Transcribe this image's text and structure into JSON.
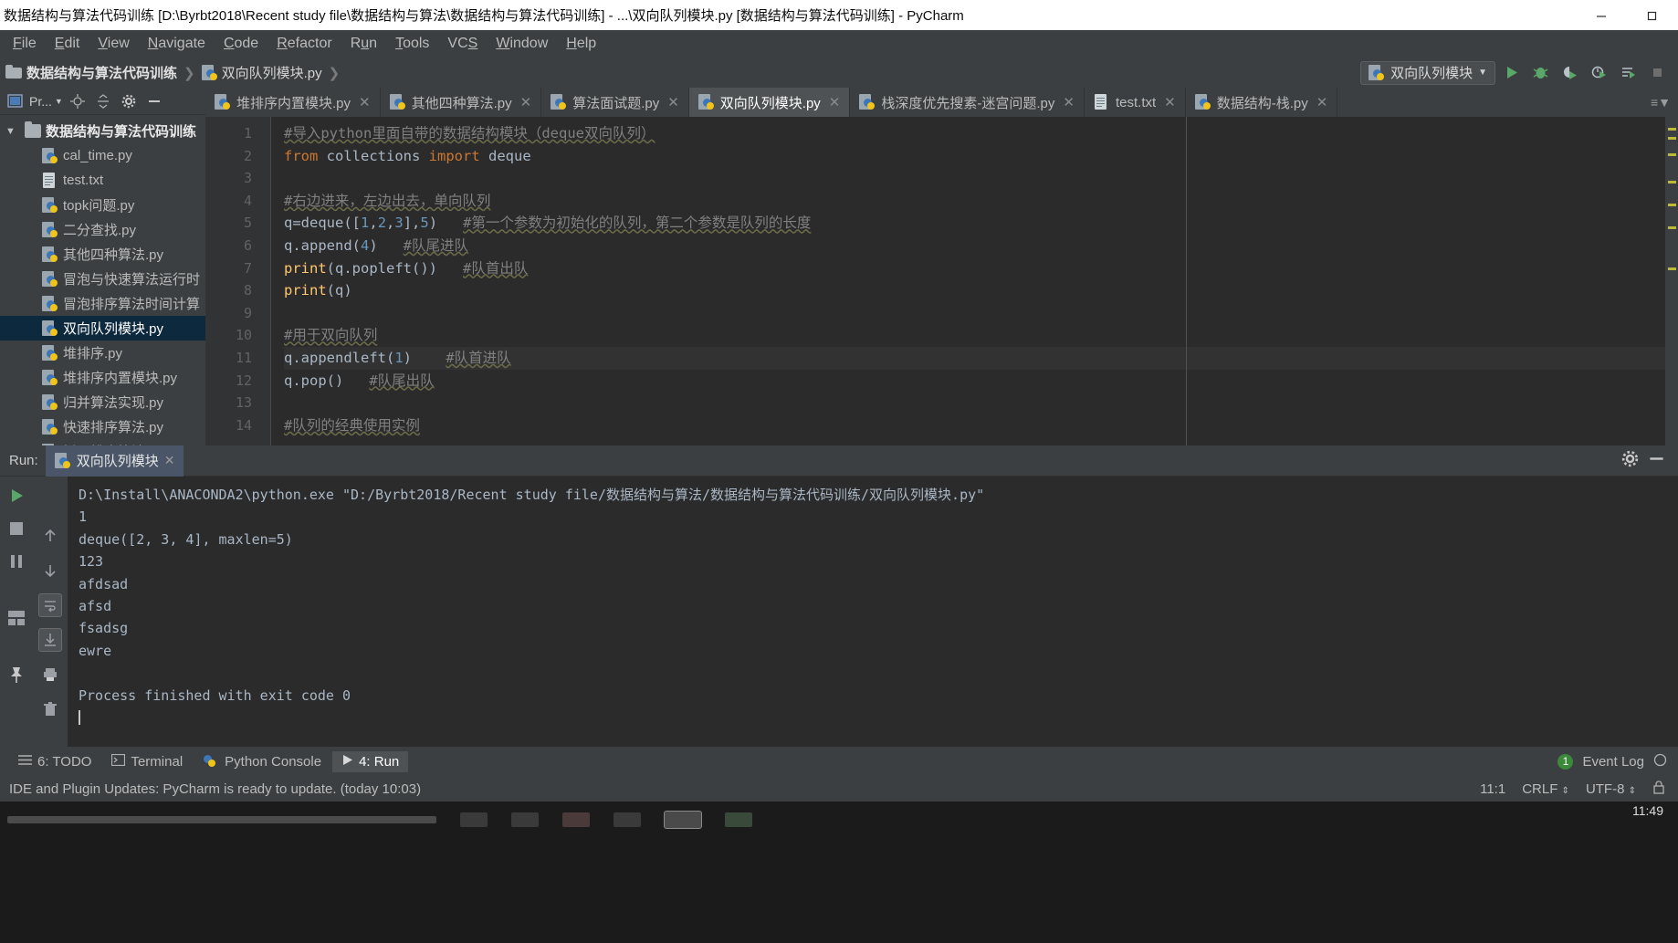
{
  "window": {
    "title": "数据结构与算法代码训练 [D:\\Byrbt2018\\Recent study file\\数据结构与算法\\数据结构与算法代码训练] - ...\\双向队列模块.py [数据结构与算法代码训练] - PyCharm",
    "minimize_icon": "minimize-icon",
    "restore_icon": "restore-icon"
  },
  "menubar": {
    "items": [
      {
        "label": "File"
      },
      {
        "label": "Edit"
      },
      {
        "label": "View"
      },
      {
        "label": "Navigate"
      },
      {
        "label": "Code"
      },
      {
        "label": "Refactor"
      },
      {
        "label": "Run"
      },
      {
        "label": "Tools"
      },
      {
        "label": "VCS"
      },
      {
        "label": "Window"
      },
      {
        "label": "Help"
      }
    ]
  },
  "navbar": {
    "crumbs": [
      {
        "label": "数据结构与算法代码训练"
      },
      {
        "label": "双向队列模块.py"
      }
    ],
    "run_config": "双向队列模块",
    "dropdown_icon": "chevron-down-icon",
    "buttons": [
      {
        "name": "run-button",
        "icon": "play-icon"
      },
      {
        "name": "debug-button",
        "icon": "bug-icon"
      },
      {
        "name": "run-coverage-button",
        "icon": "coverage-icon"
      },
      {
        "name": "profile-button",
        "icon": "profile-icon"
      },
      {
        "name": "run-with-console-button",
        "icon": "run-console-icon"
      },
      {
        "name": "stop-button",
        "icon": "stop-icon"
      }
    ]
  },
  "project_panel": {
    "title": "Pr...",
    "toolbar_icons": [
      "locate-icon",
      "collapse-all-icon",
      "settings-gear-icon",
      "hide-icon"
    ],
    "root": "数据结构与算法代码训练",
    "items": [
      {
        "label": "cal_time.py",
        "icon": "python-file-icon",
        "selected": false
      },
      {
        "label": "test.txt",
        "icon": "text-file-icon",
        "selected": false
      },
      {
        "label": "topk问题.py",
        "icon": "python-file-icon",
        "selected": false
      },
      {
        "label": "二分查找.py",
        "icon": "python-file-icon",
        "selected": false
      },
      {
        "label": "其他四种算法.py",
        "icon": "python-file-icon",
        "selected": false
      },
      {
        "label": "冒泡与快速算法运行时",
        "icon": "python-file-icon",
        "selected": false
      },
      {
        "label": "冒泡排序算法时间计算",
        "icon": "python-file-icon",
        "selected": false
      },
      {
        "label": "双向队列模块.py",
        "icon": "python-file-icon",
        "selected": true
      },
      {
        "label": "堆排序.py",
        "icon": "python-file-icon",
        "selected": false
      },
      {
        "label": "堆排序内置模块.py",
        "icon": "python-file-icon",
        "selected": false
      },
      {
        "label": "归并算法实现.py",
        "icon": "python-file-icon",
        "selected": false
      },
      {
        "label": "快速排序算法.py",
        "icon": "python-file-icon",
        "selected": false
      },
      {
        "label": "插入排序算法",
        "icon": "python-file-icon",
        "selected": false
      }
    ]
  },
  "editor": {
    "tabs": [
      {
        "label": "堆排序内置模块.py",
        "icon": "python-file-icon",
        "active": false
      },
      {
        "label": "其他四种算法.py",
        "icon": "python-file-icon",
        "active": false
      },
      {
        "label": "算法面试题.py",
        "icon": "python-file-icon",
        "active": false
      },
      {
        "label": "双向队列模块.py",
        "icon": "python-file-icon",
        "active": true
      },
      {
        "label": "栈深度优先搜素-迷宫问题.py",
        "icon": "python-file-icon",
        "active": false
      },
      {
        "label": "test.txt",
        "icon": "text-file-icon",
        "active": false
      },
      {
        "label": "数据结构-栈.py",
        "icon": "python-file-icon",
        "active": false
      }
    ],
    "line_numbers": [
      "1",
      "2",
      "3",
      "4",
      "5",
      "6",
      "7",
      "8",
      "9",
      "10",
      "11",
      "12",
      "13",
      "14"
    ],
    "lines": [
      {
        "n": 1,
        "tokens": [
          {
            "t": "comment",
            "v": "#导入python里面自带的数据结构模块（deque双向队列）"
          }
        ]
      },
      {
        "n": 2,
        "tokens": [
          {
            "t": "kw",
            "v": "from"
          },
          {
            "t": "plain",
            "v": " collections "
          },
          {
            "t": "kw",
            "v": "import"
          },
          {
            "t": "plain",
            "v": " deque"
          }
        ]
      },
      {
        "n": 3,
        "tokens": []
      },
      {
        "n": 4,
        "tokens": [
          {
            "t": "comment",
            "v": "#右边进来，左边出去，单向队列"
          }
        ]
      },
      {
        "n": 5,
        "tokens": [
          {
            "t": "plain",
            "v": "q=deque(["
          },
          {
            "t": "num",
            "v": "1"
          },
          {
            "t": "plain",
            "v": ","
          },
          {
            "t": "num",
            "v": "2"
          },
          {
            "t": "plain",
            "v": ","
          },
          {
            "t": "num",
            "v": "3"
          },
          {
            "t": "plain",
            "v": "],"
          },
          {
            "t": "num",
            "v": "5"
          },
          {
            "t": "plain",
            "v": ")   "
          },
          {
            "t": "comment",
            "v": "#第一个参数为初始化的队列，第二个参数是队列的长度"
          }
        ]
      },
      {
        "n": 6,
        "tokens": [
          {
            "t": "plain",
            "v": "q.append("
          },
          {
            "t": "num",
            "v": "4"
          },
          {
            "t": "plain",
            "v": ")   "
          },
          {
            "t": "comment",
            "v": "#队尾进队"
          }
        ]
      },
      {
        "n": 7,
        "tokens": [
          {
            "t": "fn",
            "v": "print"
          },
          {
            "t": "plain",
            "v": "(q.popleft())   "
          },
          {
            "t": "comment",
            "v": "#队首出队"
          }
        ]
      },
      {
        "n": 8,
        "tokens": [
          {
            "t": "fn",
            "v": "print"
          },
          {
            "t": "plain",
            "v": "(q)"
          }
        ]
      },
      {
        "n": 9,
        "tokens": []
      },
      {
        "n": 10,
        "tokens": [
          {
            "t": "comment",
            "v": "#用于双向队列"
          }
        ]
      },
      {
        "n": 11,
        "tokens": [
          {
            "t": "plain",
            "v": "q.appendleft("
          },
          {
            "t": "num",
            "v": "1"
          },
          {
            "t": "plain",
            "v": ")    "
          },
          {
            "t": "comment",
            "v": "#队首进队"
          }
        ]
      },
      {
        "n": 12,
        "tokens": [
          {
            "t": "plain",
            "v": "q.pop()   "
          },
          {
            "t": "comment",
            "v": "#队尾出队"
          }
        ]
      },
      {
        "n": 13,
        "tokens": []
      },
      {
        "n": 14,
        "tokens": [
          {
            "t": "comment",
            "v": "#队列的经典使用实例"
          }
        ]
      }
    ]
  },
  "run_panel": {
    "label": "Run:",
    "tab_label": "双向队列模块",
    "close_icon": "close-icon",
    "gear_icon": "settings-gear-icon",
    "minimize_icon": "minimize-icon",
    "side_buttons": [
      {
        "name": "rerun-button",
        "icon": "play-icon"
      },
      {
        "name": "stop-button",
        "icon": "stop-icon"
      },
      {
        "name": "pause-button",
        "icon": "pause-icon"
      },
      {
        "name": "restore-layout-button",
        "icon": "layout-icon"
      }
    ],
    "side_buttons2": [
      {
        "name": "scroll-up-button",
        "icon": "arrow-up-icon"
      },
      {
        "name": "scroll-down-button",
        "icon": "arrow-down-icon"
      },
      {
        "name": "soft-wrap-button",
        "icon": "wrap-icon"
      },
      {
        "name": "scroll-to-end-button",
        "icon": "scroll-end-icon"
      },
      {
        "name": "print-button",
        "icon": "print-icon"
      },
      {
        "name": "clear-all-button",
        "icon": "trash-icon"
      },
      {
        "name": "pin-tab-button",
        "icon": "pin-icon"
      }
    ],
    "console_lines": [
      "D:\\Install\\ANACONDA2\\python.exe \"D:/Byrbt2018/Recent study file/数据结构与算法/数据结构与算法代码训练/双向队列模块.py\"",
      "1",
      "deque([2, 3, 4], maxlen=5)",
      "123",
      "afdsad",
      "afsd",
      "fsadsg",
      "ewre",
      "",
      "Process finished with exit code 0"
    ]
  },
  "bottom_strip": {
    "items": [
      {
        "label": "6: TODO",
        "icon": "todo-icon",
        "active": false
      },
      {
        "label": "Terminal",
        "icon": "terminal-icon",
        "active": false
      },
      {
        "label": "Python Console",
        "icon": "python-console-icon",
        "active": false
      },
      {
        "label": "4: Run",
        "icon": "play-icon",
        "active": true
      }
    ],
    "event_log": {
      "label": "Event Log",
      "count": "1",
      "icon": "event-log-icon"
    }
  },
  "statusbar": {
    "message": "IDE and Plugin Updates: PyCharm is ready to update. (today 10:03)",
    "position": "11:1",
    "line_separator": "CRLF",
    "encoding": "UTF-8",
    "lock_icon": "lock-icon"
  },
  "taskbar": {
    "clock_time": "11:49"
  },
  "colors": {
    "ide_bg": "#3c3f41",
    "editor_bg": "#2b2b2b",
    "accent_selection": "#0d293e",
    "run_tab_bg": "#4a5668",
    "keyword": "#cc7832",
    "comment": "#808080",
    "number": "#6897bb",
    "function": "#ffc66d",
    "text": "#a9b7c6"
  }
}
